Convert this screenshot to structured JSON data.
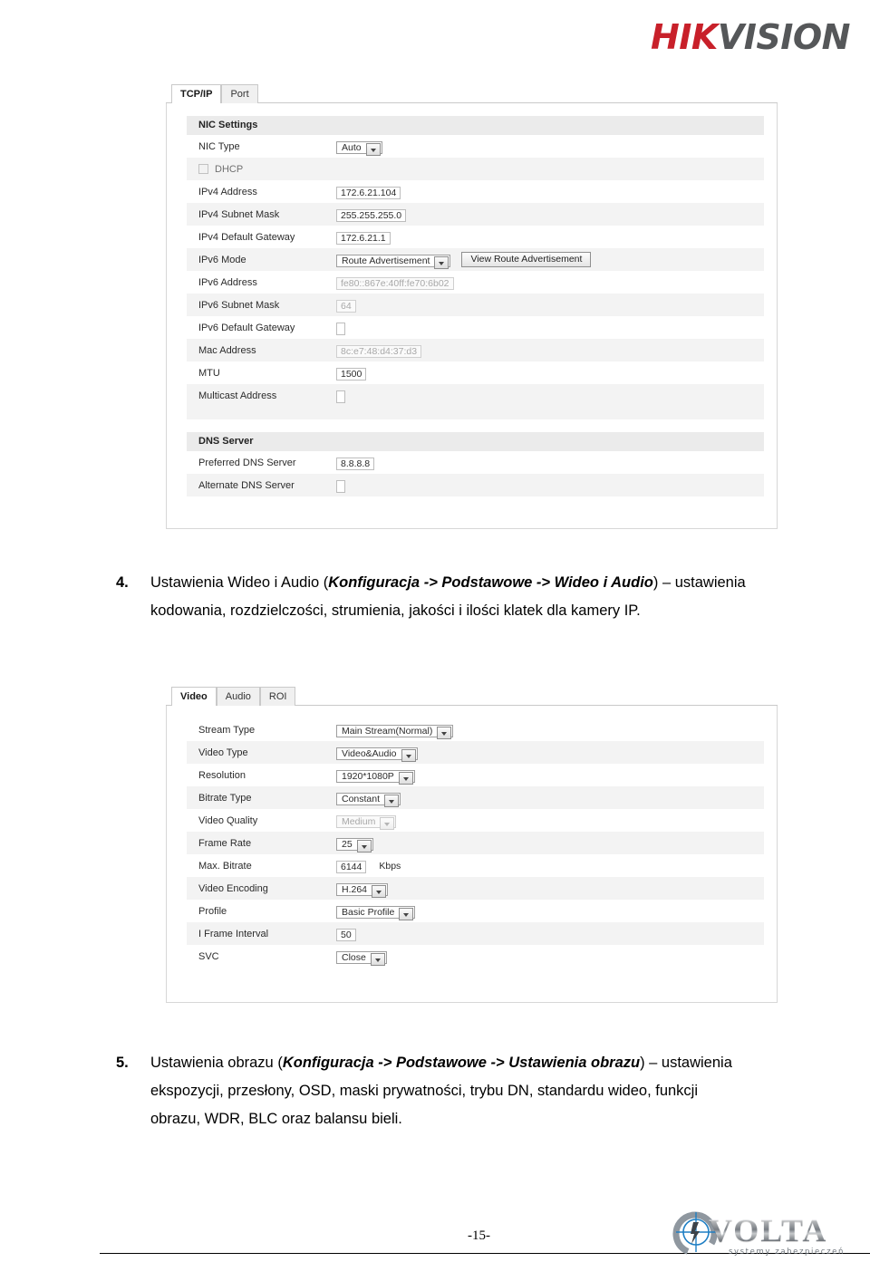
{
  "brand": {
    "part1": "HIK",
    "part2": "VISION"
  },
  "screenshot_tcpip": {
    "tabs": [
      {
        "label": "TCP/IP",
        "active": true
      },
      {
        "label": "Port",
        "active": false
      }
    ],
    "sections": [
      {
        "band": "NIC Settings",
        "rows": [
          {
            "label": "NIC Type",
            "control": "select",
            "value": "Auto"
          },
          {
            "label": "",
            "control": "checkbox",
            "checkbox_label": "DHCP",
            "checked": false
          },
          {
            "label": "IPv4 Address",
            "control": "input",
            "value": "172.6.21.104"
          },
          {
            "label": "IPv4 Subnet Mask",
            "control": "input",
            "value": "255.255.255.0"
          },
          {
            "label": "IPv4 Default Gateway",
            "control": "input",
            "value": "172.6.21.1"
          },
          {
            "label": "IPv6 Mode",
            "control": "select",
            "value": "Route Advertisement",
            "button": "View Route Advertisement"
          },
          {
            "label": "IPv6 Address",
            "control": "input",
            "value": "fe80::867e:40ff:fe70:6b02",
            "disabled": true
          },
          {
            "label": "IPv6 Subnet Mask",
            "control": "input",
            "value": "64",
            "disabled": true
          },
          {
            "label": "IPv6 Default Gateway",
            "control": "input",
            "value": ""
          },
          {
            "label": "Mac Address",
            "control": "input",
            "value": "8c:e7:48:d4:37:d3",
            "disabled": true
          },
          {
            "label": "MTU",
            "control": "input",
            "value": "1500"
          },
          {
            "label": "Multicast Address",
            "control": "input",
            "value": ""
          }
        ]
      },
      {
        "band": "DNS Server",
        "rows": [
          {
            "label": "Preferred DNS Server",
            "control": "input",
            "value": "8.8.8.8"
          },
          {
            "label": "Alternate DNS Server",
            "control": "input",
            "value": ""
          }
        ]
      }
    ]
  },
  "paragraph_4": {
    "number": "4.",
    "run1": "Ustawienia Wideo i Audio (",
    "bold1": "Konfiguracja -> Podstawowe -> Wideo i Audio",
    "run2": ") – ustawienia kodowania, rozdzielczości, strumienia, jakości i ilości klatek dla kamery IP."
  },
  "screenshot_video": {
    "tabs": [
      {
        "label": "Video",
        "active": true
      },
      {
        "label": "Audio",
        "active": false
      },
      {
        "label": "ROI",
        "active": false
      }
    ],
    "rows": [
      {
        "label": "Stream Type",
        "control": "select",
        "value": "Main Stream(Normal)"
      },
      {
        "label": "Video Type",
        "control": "select",
        "value": "Video&Audio"
      },
      {
        "label": "Resolution",
        "control": "select",
        "value": "1920*1080P"
      },
      {
        "label": "Bitrate Type",
        "control": "select",
        "value": "Constant"
      },
      {
        "label": "Video Quality",
        "control": "select",
        "value": "Medium",
        "disabled": true
      },
      {
        "label": "Frame Rate",
        "control": "select",
        "value": "25"
      },
      {
        "label": "Max. Bitrate",
        "control": "input",
        "value": "6144",
        "unit": "Kbps"
      },
      {
        "label": "Video Encoding",
        "control": "select",
        "value": "H.264"
      },
      {
        "label": "Profile",
        "control": "select",
        "value": "Basic Profile"
      },
      {
        "label": "I Frame Interval",
        "control": "input",
        "value": "50"
      },
      {
        "label": "SVC",
        "control": "select",
        "value": "Close"
      }
    ]
  },
  "paragraph_5": {
    "number": "5.",
    "run1": "Ustawienia obrazu (",
    "bold1": "Konfiguracja -> Podstawowe -> Ustawienia obrazu",
    "run2": ") – ustawienia ekspozycji, przesłony, OSD, maski prywatności, trybu DN, standardu wideo, funkcji obrazu, WDR, BLC oraz balansu bieli."
  },
  "footer": {
    "page_number": "-15-",
    "volta_word": "VOLTA",
    "volta_tagline": "systemy zabezpieczeń"
  }
}
